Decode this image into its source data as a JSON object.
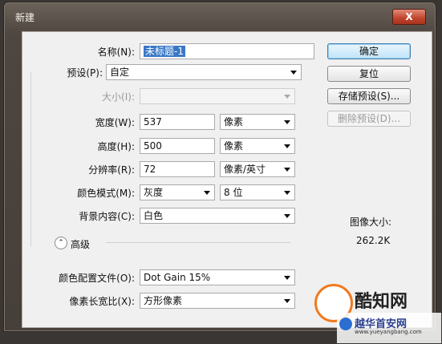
{
  "window": {
    "title": "新建",
    "close_label": "X"
  },
  "form": {
    "name_label": "名称(N):",
    "name_value": "未标题-1",
    "preset_label": "预设(P):",
    "preset_value": "自定",
    "size_label": "大小(I):",
    "size_value": "",
    "width_label": "宽度(W):",
    "width_value": "537",
    "width_unit": "像素",
    "height_label": "高度(H):",
    "height_value": "500",
    "height_unit": "像素",
    "resolution_label": "分辨率(R):",
    "resolution_value": "72",
    "resolution_unit": "像素/英寸",
    "color_mode_label": "颜色模式(M):",
    "color_mode_value": "灰度",
    "bit_depth_value": "8 位",
    "background_label": "背景内容(C):",
    "background_value": "白色",
    "advanced_label": "高级",
    "color_profile_label": "颜色配置文件(O):",
    "color_profile_value": "Dot Gain 15%",
    "pixel_aspect_label": "像素长宽比(X):",
    "pixel_aspect_value": "方形像素"
  },
  "buttons": {
    "ok": "确定",
    "reset": "复位",
    "save_preset": "存储预设(S)...",
    "delete_preset": "删除预设(D)..."
  },
  "info": {
    "image_size_label": "图像大小:",
    "image_size_value": "262.2K"
  },
  "watermark": {
    "brand": "酷知网",
    "brand2": "越华首安网",
    "url": "www.yueyangbang.com"
  },
  "colors": {
    "accent": "#3a78c6",
    "title_bar": "#5e564f"
  }
}
